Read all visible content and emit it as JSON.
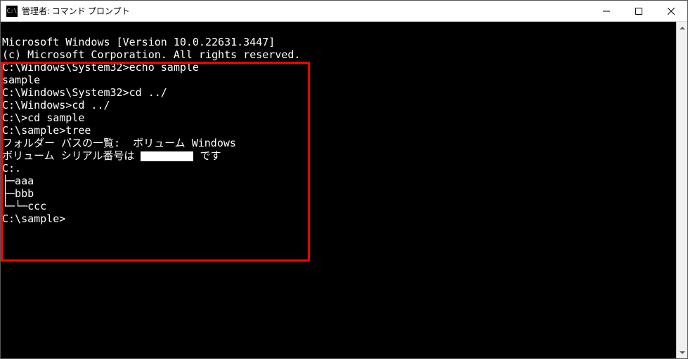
{
  "window": {
    "icon_text": "C:\\",
    "title": "管理者: コマンド プロンプト"
  },
  "terminal": {
    "line1": "Microsoft Windows [Version 10.0.22631.3447]",
    "line2": "(c) Microsoft Corporation. All rights reserved.",
    "blank": "",
    "prompt1": "C:\\Windows\\System32>echo sample",
    "out1": "sample",
    "prompt2": "C:\\Windows\\System32>cd ../",
    "prompt3": "C:\\Windows>cd ../",
    "prompt4": "C:\\>cd sample",
    "prompt5": "C:\\sample>tree",
    "tree1": "フォルダー パスの一覧:  ボリューム Windows",
    "tree2a": "ボリューム シリアル番号は ",
    "tree2b": " です",
    "tree3": "C:.",
    "tree4": "├─aaa",
    "tree5": "├─bbb",
    "tree6": "└─└─ccc",
    "prompt6": "C:\\sample>"
  }
}
